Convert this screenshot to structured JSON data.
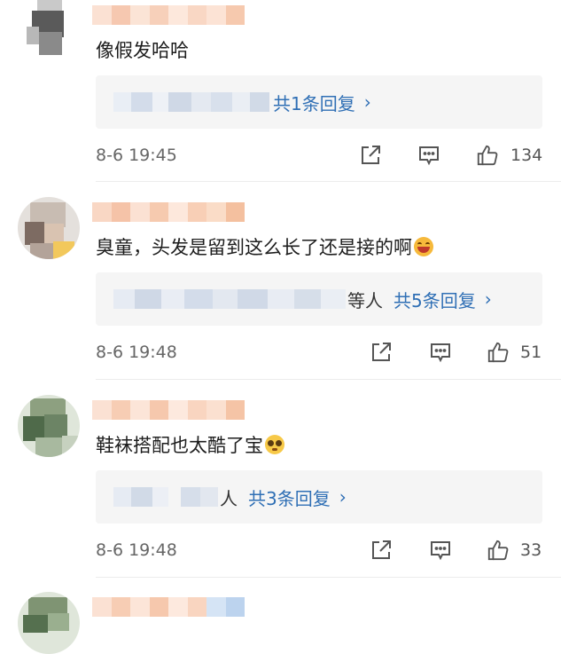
{
  "comments": [
    {
      "text": "像假发哈哈",
      "reply_extra": "",
      "reply_count": "共1条回复",
      "chevron": "›",
      "time": "8-6 19:45",
      "likes": "134",
      "emoji": ""
    },
    {
      "text": "臭童，头发是留到这么长了还是接的啊",
      "reply_extra": "等人",
      "reply_count": "共5条回复",
      "chevron": "›",
      "time": "8-6 19:48",
      "likes": "51",
      "emoji": "laughing-emoji"
    },
    {
      "text": "鞋袜搭配也太酷了宝",
      "reply_extra": "人",
      "reply_count": "共3条回复",
      "chevron": "›",
      "time": "8-6 19:48",
      "likes": "33",
      "emoji": "pleading-emoji"
    }
  ],
  "icons": {
    "share": "share-icon",
    "comment": "comment-icon",
    "like": "thumbs-up-icon"
  },
  "colors": {
    "reply_link": "#2f6fb5",
    "reply_bg": "#f5f5f5"
  }
}
